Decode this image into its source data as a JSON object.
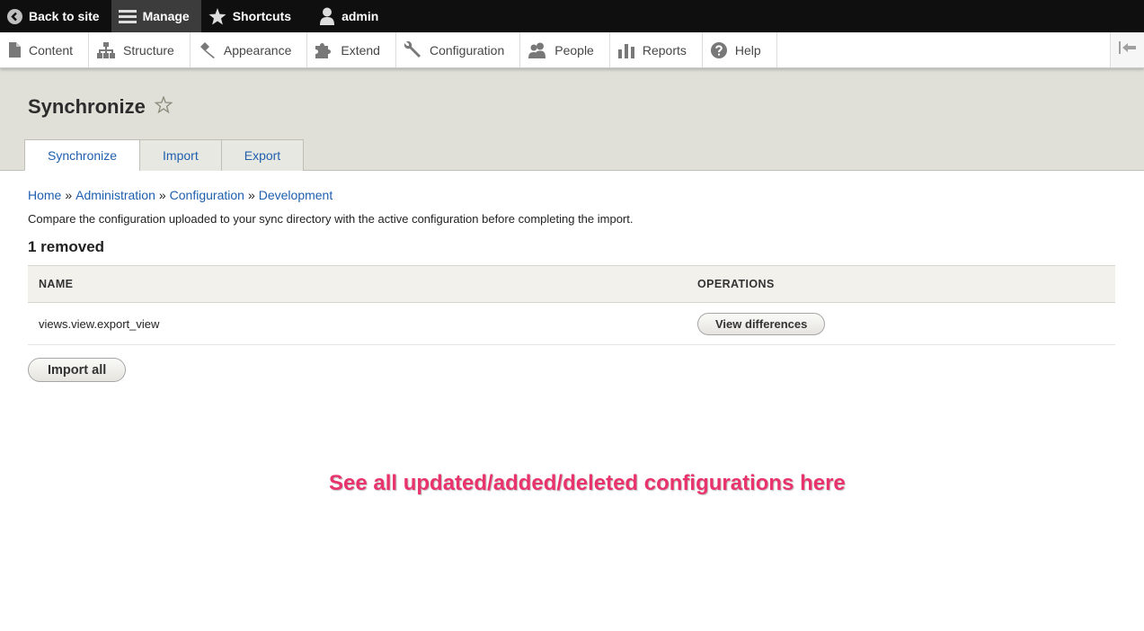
{
  "toolbar": {
    "back_label": "Back to site",
    "manage_label": "Manage",
    "shortcuts_label": "Shortcuts",
    "user_label": "admin"
  },
  "tray": {
    "items": [
      {
        "label": "Content",
        "icon": "document-icon"
      },
      {
        "label": "Structure",
        "icon": "sitemap-icon"
      },
      {
        "label": "Appearance",
        "icon": "brush-icon"
      },
      {
        "label": "Extend",
        "icon": "puzzle-icon"
      },
      {
        "label": "Configuration",
        "icon": "wrench-icon"
      },
      {
        "label": "People",
        "icon": "people-icon"
      },
      {
        "label": "Reports",
        "icon": "bar-chart-icon"
      },
      {
        "label": "Help",
        "icon": "help-icon"
      }
    ]
  },
  "page": {
    "title": "Synchronize",
    "tabs": [
      {
        "label": "Synchronize",
        "active": true
      },
      {
        "label": "Import",
        "active": false
      },
      {
        "label": "Export",
        "active": false
      }
    ]
  },
  "breadcrumb": {
    "items": [
      "Home",
      "Administration",
      "Configuration",
      "Development"
    ],
    "separator": "»"
  },
  "description": "Compare the configuration uploaded to your sync directory with the active configuration before completing the import.",
  "section_title": "1 removed",
  "table": {
    "headers": [
      "Name",
      "Operations"
    ],
    "rows": [
      {
        "name": "views.view.export_view",
        "operation": "View differences"
      }
    ]
  },
  "import_all_label": "Import all",
  "annotation": "See all updated/added/deleted configurations here",
  "colors": {
    "link": "#1f5fae",
    "annotation": "#e8336d",
    "header_bg": "#e0e0d8",
    "toolbar_bg": "#0f0f0f"
  }
}
